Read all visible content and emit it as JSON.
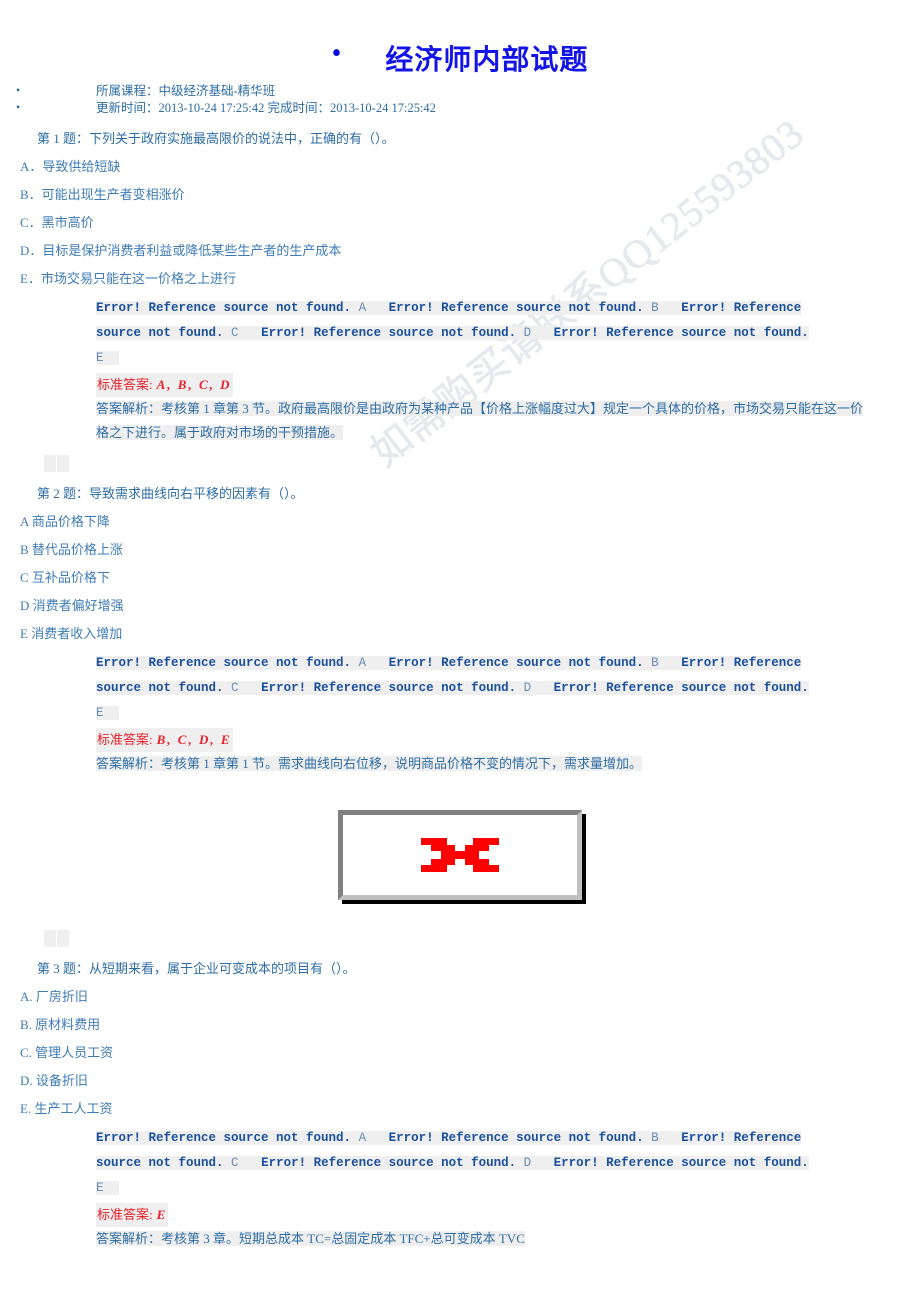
{
  "header": {
    "bullet_glyph": "•",
    "title": "经济师内部试题",
    "meta": [
      "所属课程：中级经济基础-精华班",
      "更新时间：2013-10-24 17:25:42 完成时间：2013-10-24 17:25:42"
    ]
  },
  "watermark": {
    "text": "如需购买请联系QQ125593803"
  },
  "reference_error": {
    "message": "Error! Reference source not found.",
    "letters": [
      "A",
      "B",
      "C",
      "D",
      "E"
    ]
  },
  "labels": {
    "standard_answer": "标准答案:",
    "explanation_prefix": "答案解析："
  },
  "colors": {
    "title": "#1414e6",
    "body_blue": "#2e6da4",
    "answer_red": "#e8202a",
    "highlight_bg": "#efefef",
    "broken_x": "#ff0000"
  },
  "questions": [
    {
      "stem": "第 1 题：下列关于政府实施最高限价的说法中，正确的有（）。",
      "options": [
        "A．导致供给短缺",
        "B．可能出现生产者变相涨价",
        "C．黑市高价",
        "D．目标是保护消费者利益或降低某些生产者的生产成本",
        "E．市场交易只能在这一价格之上进行"
      ],
      "standard_answer": "A, B, C, D",
      "explanation": "答案解析：考核第 1 章第 3 节。政府最高限价是由政府为某种产品【价格上涨幅度过大】规定一个具体的价格，市场交易只能在这一价格之下进行。属于政府对市场的干预措施。"
    },
    {
      "stem": "第 2 题：导致需求曲线向右平移的因素有（）。",
      "options": [
        "A 商品价格下降",
        "B 替代品价格上涨",
        "C 互补品价格下",
        "D 消费者偏好增强",
        "E 消费者收入增加"
      ],
      "standard_answer": "B, C, D, E",
      "explanation": "答案解析：考核第 1 章第 1 节。需求曲线向右位移，说明商品价格不变的情况下，需求量增加。"
    },
    {
      "stem": "第 3 题：从短期来看，属于企业可变成本的项目有（）。",
      "options": [
        "A. 厂房折旧",
        "B. 原材料费用",
        "C. 管理人员工资",
        "D. 设备折旧",
        "E. 生产工人工资"
      ],
      "standard_answer": "E",
      "explanation": "答案解析：考核第 3 章。短期总成本 TC=总固定成本 TFC+总可变成本 TVC"
    }
  ],
  "broken_image": {
    "alt_icon": "broken-image-red-x"
  }
}
